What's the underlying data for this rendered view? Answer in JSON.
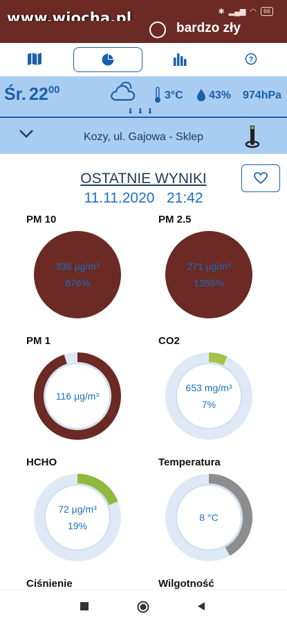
{
  "watermark": "www.wiocha.pl",
  "status_bar": {
    "battery": "66"
  },
  "banner": {
    "status_text": "bardzo zły"
  },
  "nav": {
    "items": [
      {
        "icon": "map-icon"
      },
      {
        "icon": "pie-chart-icon",
        "active": true
      },
      {
        "icon": "bar-chart-icon"
      },
      {
        "icon": "help-icon"
      }
    ]
  },
  "weather": {
    "day": "Śr.",
    "hour": "22",
    "minutes": "00",
    "icon": "cloud-icon",
    "arrows": "⬇⬇⬇",
    "temperature": "3°C",
    "humidity": "43%",
    "pressure": "974hPa"
  },
  "station": {
    "name": "Kozy, ul. Gajowa - Sklep"
  },
  "results": {
    "title": "OSTATNIE WYNIKI",
    "date": "11.11.2020",
    "time": "21:42"
  },
  "colors": {
    "danger": "#6b2a24",
    "ok": "#8fba3e",
    "neutral": "#8e8e8e",
    "accent": "#1d5fa8",
    "text_blue": "#1d6fc0"
  },
  "gauges": [
    {
      "label": "PM 10",
      "line1": "338 µg/m³",
      "line2": "676%",
      "percent": 676,
      "color": "#6b2a24"
    },
    {
      "label": "PM 2.5",
      "line1": "271 µg/m³",
      "line2": "1355%",
      "percent": 1355,
      "color": "#6b2a24"
    },
    {
      "label": "PM 1",
      "line1": "116 µg/m³",
      "line2": "",
      "fill": 0.95,
      "color": "#6b2a24"
    },
    {
      "label": "CO2",
      "line1": "653 mg/m³",
      "line2": "7%",
      "percent": 7,
      "color": "#a8c14a"
    },
    {
      "label": "HCHO",
      "line1": "72 µg/m³",
      "line2": "19%",
      "percent": 19,
      "color": "#8fba3e"
    },
    {
      "label": "Temperatura",
      "line1": "8 °C",
      "line2": "",
      "fill": 0.42,
      "color": "#8e8e8e"
    },
    {
      "label": "Ciśnienie"
    },
    {
      "label": "Wilgotność"
    }
  ]
}
